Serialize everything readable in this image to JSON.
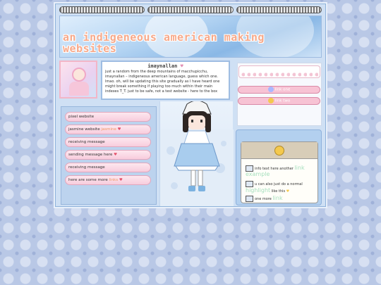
{
  "header": {
    "title": "an indigeneous american making websites"
  },
  "intro": {
    "title": "imaynallan",
    "text": "just a random from the deep mountains of macchupicchu, imaynallan – indigeneous american language, guess which one. lmao. oh, will be updating this site gradually as I have heard one might break something if playing too much within their main indexes T_T. just to be safe, not a test website - here to the box"
  },
  "right_links": [
    {
      "label": "link one",
      "icon": "flower-icon",
      "icon_color": "#a9b7ff"
    },
    {
      "label": "link two",
      "icon": "heart-icon",
      "icon_color": "#f4c94e"
    }
  ],
  "nav": [
    {
      "label": "pixel website",
      "accent": "",
      "icon": ""
    },
    {
      "label": "jasmine website",
      "accent": "jasmine",
      "icon": "heart-icon"
    },
    {
      "label": "receiving message",
      "accent": "",
      "icon": ""
    },
    {
      "label": "sending message here",
      "accent": "",
      "icon": "heart-icon"
    },
    {
      "label": "receiving message",
      "accent": "",
      "icon": ""
    },
    {
      "label": "here are some more",
      "accent": "links",
      "icon": "heart-icon"
    }
  ],
  "card": {
    "row1_text": "info text here another",
    "row1_green": "link example",
    "row2_text": "u can also just do a normal",
    "row3_green": "highlight",
    "row3_text": "like this",
    "row4_text": "one more",
    "row4_green": "link"
  },
  "colors": {
    "accent_pink": "#f7c3d4",
    "accent_orange": "#f09a64",
    "accent_green": "#a5dfbd",
    "panel_blue": "#bcd3ee"
  }
}
